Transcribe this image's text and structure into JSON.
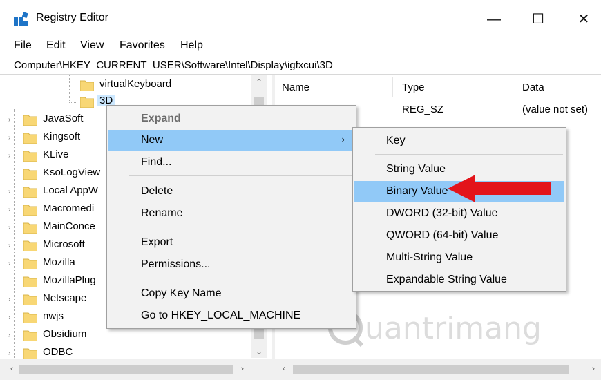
{
  "window": {
    "title": "Registry Editor",
    "minimize": "—",
    "maximize": "☐",
    "close": "✕"
  },
  "menu": [
    "File",
    "Edit",
    "View",
    "Favorites",
    "Help"
  ],
  "address": "Computer\\HKEY_CURRENT_USER\\Software\\Intel\\Display\\igfxcui\\3D",
  "tree": {
    "items": [
      {
        "label": "virtualKeyboard",
        "selected": false
      },
      {
        "label": "3D",
        "selected": true
      },
      {
        "label": "JavaSoft"
      },
      {
        "label": "Kingsoft"
      },
      {
        "label": "KLive"
      },
      {
        "label": "KsoLogView"
      },
      {
        "label": "Local AppW"
      },
      {
        "label": "Macromedi"
      },
      {
        "label": "MainConce"
      },
      {
        "label": "Microsoft"
      },
      {
        "label": "Mozilla"
      },
      {
        "label": "MozillaPlug"
      },
      {
        "label": "Netscape"
      },
      {
        "label": "nwjs"
      },
      {
        "label": "Obsidium"
      },
      {
        "label": "ODBC"
      }
    ]
  },
  "list": {
    "columns": [
      "Name",
      "Type",
      "Data"
    ],
    "rows": [
      {
        "name": "",
        "type": "REG_SZ",
        "data": "(value not set)"
      }
    ]
  },
  "context_menu": {
    "items": [
      "Expand",
      "New",
      "Find...",
      "Delete",
      "Rename",
      "Export",
      "Permissions...",
      "Copy Key Name",
      "Go to HKEY_LOCAL_MACHINE"
    ],
    "highlighted": "New",
    "submenu_arrow": "›"
  },
  "new_submenu": {
    "items": [
      "Key",
      "String Value",
      "Binary Value",
      "DWORD (32-bit) Value",
      "QWORD (64-bit) Value",
      "Multi-String Value",
      "Expandable String Value"
    ],
    "highlighted": "Binary Value"
  },
  "watermark": "uantrimang",
  "colors": {
    "highlight": "#91c9f7",
    "menu_bg": "#f2f2f2",
    "folder": "#f8d775",
    "arrow": "#e3141b"
  }
}
